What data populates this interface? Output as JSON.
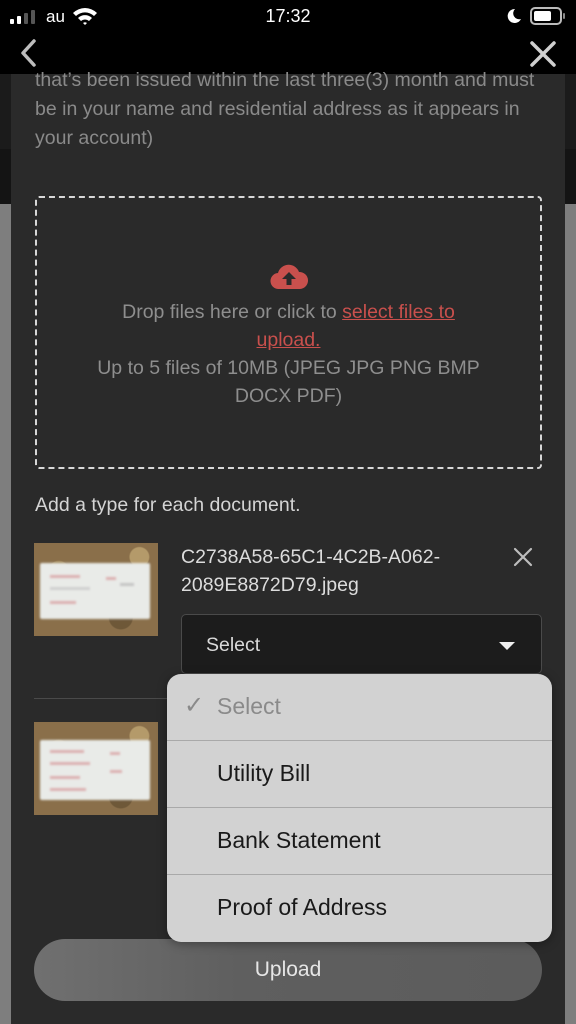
{
  "status_bar": {
    "carrier": "au",
    "time": "17:32",
    "icons": [
      "cellular-signal-icon",
      "wifi-icon",
      "do-not-disturb-moon-icon",
      "battery-icon"
    ]
  },
  "nav": {
    "back_icon": "chevron-left-icon",
    "close_icon": "close-icon"
  },
  "intro_text": "that’s been issued within the last three(3) month and must be in your name and residential address as it appears in your account)",
  "dropzone": {
    "icon": "cloud-upload-icon",
    "text_prefix": "Drop files here or click to ",
    "link_text": "select files to upload.",
    "limits_text": "Up to 5 files of 10MB (JPEG JPG PNG BMP DOCX PDF)",
    "accent_color": "#c9504d"
  },
  "add_type_label": "Add a type for each document.",
  "files": [
    {
      "name": "C2738A58-65C1-4C2B-A062-2089E8872D79.jpeg",
      "type_select": "Select",
      "remove_icon": "close-icon"
    },
    {
      "name": "",
      "type_select": ""
    }
  ],
  "picker": {
    "options": [
      {
        "label": "Select",
        "selected": true
      },
      {
        "label": "Utility Bill",
        "selected": false
      },
      {
        "label": "Bank Statement",
        "selected": false
      },
      {
        "label": "Proof of Address",
        "selected": false
      }
    ],
    "check_icon": "checkmark-icon"
  },
  "upload_button": "Upload"
}
